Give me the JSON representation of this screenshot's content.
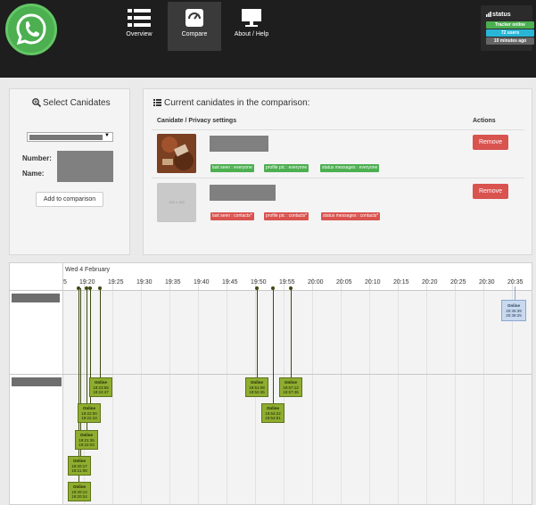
{
  "nav": {
    "items": [
      {
        "label": "Overview",
        "icon": "list-icon"
      },
      {
        "label": "Compare",
        "icon": "scale-icon"
      },
      {
        "label": "About / Help",
        "icon": "monitor-icon"
      }
    ],
    "active_index": 1
  },
  "status": {
    "title": "status",
    "tracker": "Tracker online",
    "users": "72 users",
    "updated": "10 minutes ago",
    "colors": {
      "tracker": "#4caf50",
      "users": "#29b6d6",
      "updated": "#666666"
    }
  },
  "select_panel": {
    "title": "Select Canidates",
    "number_label": "Number:",
    "name_label": "Name:",
    "add_button": "Add to comparison"
  },
  "comparison_panel": {
    "title": "Current canidates in the comparison:",
    "col_candidate": "Canidate / Privacy settings",
    "col_actions": "Actions",
    "rows": [
      {
        "avatar": "photo",
        "remove_label": "Remove",
        "tags": [
          {
            "text": "last seen : everyone",
            "color": "green"
          },
          {
            "text": "profile pic : everyone",
            "color": "green"
          },
          {
            "text": "status messages : everyone",
            "color": "green"
          }
        ]
      },
      {
        "avatar": "placeholder",
        "avatar_text": "100 x 100",
        "remove_label": "Remove",
        "tags": [
          {
            "text": "last seen : contacts*",
            "color": "red"
          },
          {
            "text": "profile pic : contacts*",
            "color": "red"
          },
          {
            "text": "status messages : contacts*",
            "color": "red"
          }
        ]
      }
    ]
  },
  "timeline": {
    "date": "Wed 4 February",
    "ticks": [
      "5",
      "19:20",
      "19:25",
      "19:30",
      "19:35",
      "19:40",
      "19:45",
      "19:50",
      "19:55",
      "20:00",
      "20:05",
      "20:10",
      "20:15",
      "20:20",
      "20:25",
      "20:30",
      "20:35"
    ],
    "row1_events": [
      {
        "label": "Online",
        "start": "20:35:39",
        "end": "20:38:25"
      }
    ],
    "row2_events": [
      {
        "label": "Online",
        "start": "19:23:55",
        "end": "19:24:47"
      },
      {
        "label": "Online",
        "start": "19:51:08",
        "end": "19:52:45"
      },
      {
        "label": "Online",
        "start": "19:57:12",
        "end": "19:57:46"
      },
      {
        "label": "Online",
        "start": "19:22:00",
        "end": "19:22:43"
      },
      {
        "label": "Online",
        "start": "19:54:22",
        "end": "19:54:51"
      },
      {
        "label": "Online",
        "start": "19:21:35",
        "end": "19:22:03"
      },
      {
        "label": "Online",
        "start": "19:20:17",
        "end": "19:21:08"
      },
      {
        "label": "Online",
        "start": "19:20:14",
        "end": "19:20:24"
      }
    ]
  }
}
